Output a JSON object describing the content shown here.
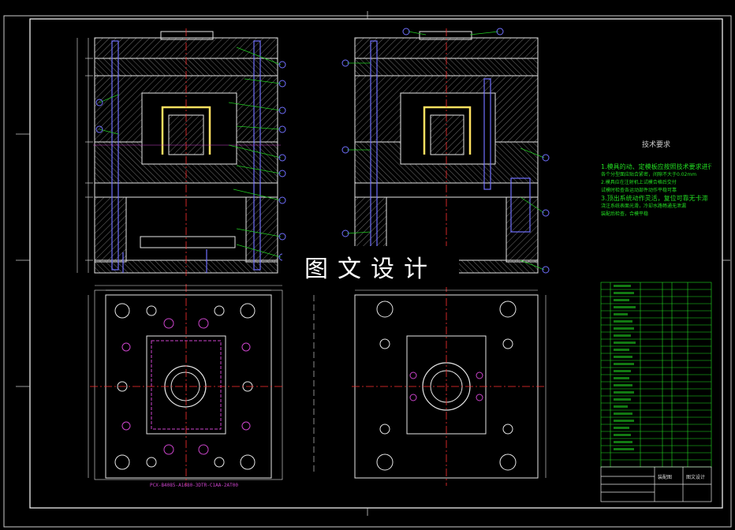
{
  "technical_requirements": {
    "title": "技术要求",
    "lines": [
      "1.模具的动、定模板应按照技术要求进行加工",
      "各个分型面应贴合紧密，间隙不大于0.02mm",
      "2.模具应在注射机上试模合格后交付",
      "试模时检查各运动部件动作平稳可靠",
      "3.顶出系统动作灵活，复位可靠无卡滞",
      "浇注系统表面光滑，冷却水路畅通无泄漏",
      "装配后检查，合模平稳"
    ]
  },
  "watermark": "图文设计",
  "bottom_label": "PCX-B4085-A1680-3DTR-C1AA-2AT00",
  "title_block": {
    "name": "装配图",
    "company": "图文设计"
  },
  "colors": {
    "background": "#000000",
    "frame": "#ffffff",
    "outline": "#e6e6e6",
    "center_line": "#ff3030",
    "bolt": "#7070ff",
    "part": "#ffe060",
    "notes": "#22dd22",
    "leader": "#22cc22"
  }
}
